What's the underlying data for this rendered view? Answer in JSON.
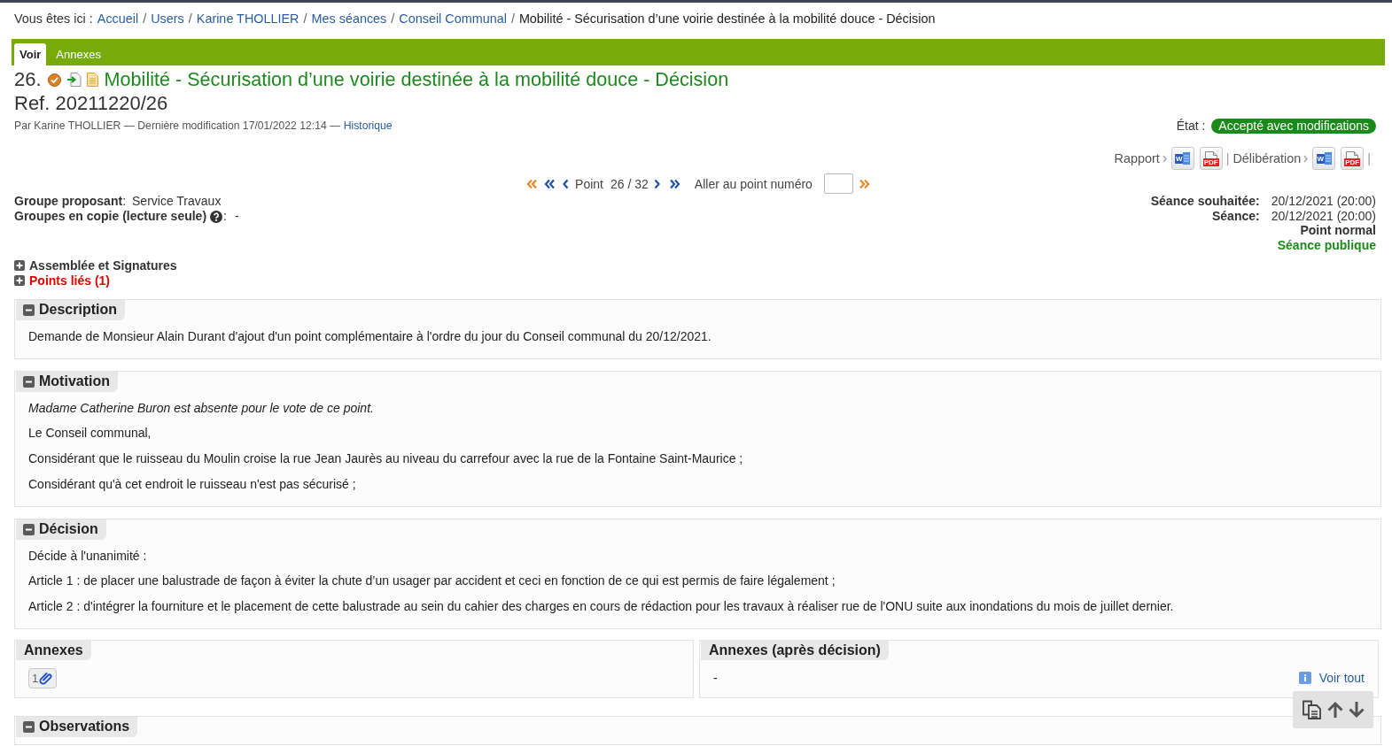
{
  "breadcrumb": {
    "prefix": "Vous êtes ici :",
    "separator": "/",
    "items": [
      {
        "label": "Accueil",
        "kind": "link"
      },
      {
        "label": "Users",
        "kind": "link"
      },
      {
        "label": "Karine THOLLIER",
        "kind": "link"
      },
      {
        "label": "Mes séances",
        "kind": "link"
      },
      {
        "label": "Conseil Communal",
        "kind": "link"
      },
      {
        "label": "Mobilité - Sécurisation d’une voirie destinée à la mobilité douce - Décision",
        "kind": "current"
      }
    ]
  },
  "tabs": [
    {
      "label": "Voir",
      "selected": true
    },
    {
      "label": "Annexes",
      "selected": false
    }
  ],
  "item": {
    "number": "26.",
    "title": "Mobilité - Sécurisation d’une voirie destinée à la mobilité douce - Décision",
    "ref": "Ref. 20211220/26",
    "byline": "Par Karine THOLLIER — Dernière modification 17/01/2022 12:14 —",
    "history_link": "Historique",
    "state": {
      "label": "État :",
      "value": "Accepté avec modifications"
    }
  },
  "documents": {
    "separator": "|",
    "groups": [
      {
        "label": "Rapport",
        "files": [
          {
            "kind": "word",
            "label": "W"
          },
          {
            "kind": "pdf",
            "label": "PDF"
          }
        ]
      },
      {
        "label": "Délibération",
        "files": [
          {
            "kind": "word",
            "label": "W"
          },
          {
            "kind": "pdf",
            "label": "PDF"
          }
        ]
      }
    ]
  },
  "navigation": {
    "label": "Point",
    "position": "26 / 32",
    "goto_label": "Aller au point numéro"
  },
  "proposal": [
    {
      "label": "Groupe proposant",
      "help": false,
      "separator": ":",
      "value": "Service Travaux"
    },
    {
      "label": "Groupes en copie (lecture seule)",
      "help": true,
      "separator": ":",
      "value": "-"
    }
  ],
  "session": {
    "rows": [
      {
        "label": "Séance souhaitée:",
        "value": "20/12/2021 (20:00)"
      },
      {
        "label": "Séance:",
        "value": "20/12/2021 (20:00)"
      }
    ],
    "flags": [
      {
        "label": "Point normal",
        "color": "#333333"
      },
      {
        "label": "Séance publique",
        "color": "#1e8a1e"
      }
    ]
  },
  "toggles": [
    {
      "label": "Assemblée et Signatures",
      "expanded": false,
      "color": "#333333"
    },
    {
      "label": "Points liés (1)",
      "expanded": false,
      "color": "#e00000"
    }
  ],
  "sections": [
    {
      "kind": "text",
      "title": "Description",
      "expanded": true,
      "paragraphs": [
        {
          "text": "Demande de Monsieur Alain Durant d'ajout d'un point complémentaire à l'ordre du jour du Conseil communal du 20/12/2021.",
          "italic": false
        }
      ]
    },
    {
      "kind": "text",
      "title": "Motivation",
      "expanded": true,
      "paragraphs": [
        {
          "text": "Madame Catherine Buron est absente pour le vote de ce point.",
          "italic": true
        },
        {
          "text": "Le Conseil communal,",
          "italic": false
        },
        {
          "text": "Considérant que le ruisseau du Moulin croise la rue Jean Jaurès au niveau du carrefour avec la rue de la Fontaine Saint-Maurice ;",
          "italic": false
        },
        {
          "text": "Considérant qu'à cet endroit le ruisseau n'est pas sécurisé ;",
          "italic": false
        }
      ]
    },
    {
      "kind": "text",
      "title": "Décision",
      "expanded": true,
      "paragraphs": [
        {
          "text": "Décide à l'unanimité :",
          "italic": false
        },
        {
          "text": "Article 1 : de placer une balustrade de façon à éviter la chute d’un usager par accident et ceci en fonction de ce qui est permis de faire légalement ;",
          "italic": false
        },
        {
          "text": "Article 2 : d'intégrer la fourniture et le placement de cette balustrade au sein du cahier des charges en cours de rédaction pour les travaux à réaliser rue de l'ONU suite aux inondations du mois de juillet dernier.",
          "italic": false
        }
      ]
    },
    {
      "kind": "annexes",
      "panels": [
        {
          "title": "Annexes",
          "files": [
            {
              "count": "1"
            }
          ]
        },
        {
          "title": "Annexes (après décision)",
          "value": "-",
          "link": "Voir tout"
        }
      ]
    },
    {
      "kind": "text",
      "title": "Observations",
      "expanded": true
    }
  ]
}
